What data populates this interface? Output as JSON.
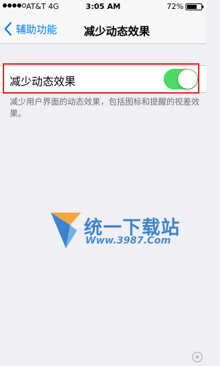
{
  "status_bar": {
    "carrier": "AT&T  4G",
    "time": "3:05 AM",
    "battery_percent": "72%",
    "battery_level": 0.72,
    "signal_bars_filled": 4,
    "signal_bars_total": 5
  },
  "nav": {
    "back_label": "辅助功能",
    "title": "减少动态效果"
  },
  "setting": {
    "label": "减少动态效果",
    "toggle_on": true,
    "toggle_color": "#4cd964",
    "highlight_color": "#e0201c"
  },
  "footer": {
    "text": "减少用户界面的动态效果，包括图标和提醒的视差效果。"
  },
  "watermark": {
    "title": "统一下载站",
    "url": "Www.3987.Com"
  },
  "icons": [
    "chevron-left-icon",
    "signal-dots-icon",
    "battery-icon",
    "download-site-logo-icon"
  ]
}
